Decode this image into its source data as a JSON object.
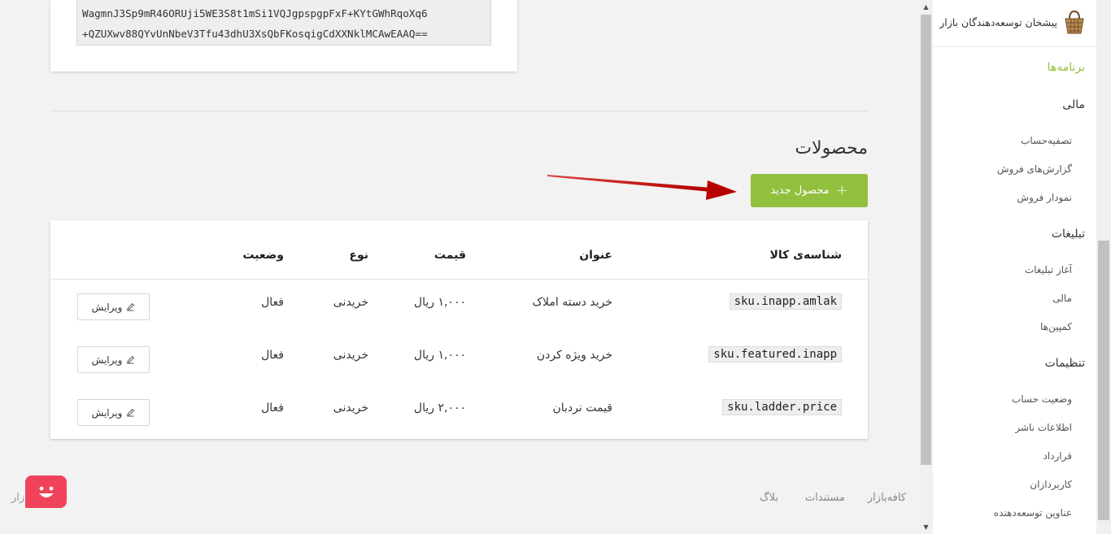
{
  "key": {
    "lines": [
      "WagmnJ3Sp9mR46ORUji5WE3S8t1mSi1VQJgpspgpFxF+KYtGWhRqoXq6",
      "+QZUXwv88QYvUnNbeV3Tfu43dhU3XsQbFKosqigCdXXNklMCAwEAAQ=="
    ]
  },
  "products": {
    "title": "محصولات",
    "new_button_label": "محصول جدید",
    "new_button_icon": "plus-icon",
    "columns": {
      "sku": "شناسه‌ی کالا",
      "title": "عنوان",
      "price": "قیمت",
      "type": "نوع",
      "status": "وضعیت"
    },
    "rows": [
      {
        "sku": "sku.inapp.amlak",
        "title": "خرید دسته املاک",
        "price": "۱,۰۰۰ ریال",
        "type": "خریدنی",
        "status": "فعال",
        "edit": "ویرایش"
      },
      {
        "sku": "sku.featured.inapp",
        "title": "خرید ویژه کردن",
        "price": "۱,۰۰۰ ریال",
        "type": "خریدنی",
        "status": "فعال",
        "edit": "ویرایش"
      },
      {
        "sku": "sku.ladder.price",
        "title": "قیمت نردبان",
        "price": "۲,۰۰۰ ریال",
        "type": "خریدنی",
        "status": "فعال",
        "edit": "ویرایش"
      }
    ]
  },
  "footer": {
    "links": [
      "کافه‌بازار",
      "مستندات",
      "بلاگ"
    ],
    "copyright": "© ۷ بازار"
  },
  "sidebar": {
    "brand": "پیشخان توسعه‌دهندگان بازار",
    "top_item": "برنامه‌ها",
    "sections": [
      {
        "label": "مالی",
        "items": [
          "تصفیه‌حساب",
          "گزارش‌های فروش",
          "نمودار فروش"
        ]
      },
      {
        "label": "تبلیغات",
        "items": [
          "آغاز تبلیغات",
          "مالی",
          "کمپین‌ها"
        ]
      },
      {
        "label": "تنظیمات",
        "items": [
          "وضعیت حساب",
          "اطلاعات ناشر",
          "قرارداد",
          "کاربردازان",
          "عناوین توسعه‌دهنده"
        ]
      }
    ]
  },
  "colors": {
    "accent": "#93bf3e",
    "arrow": "#cc1111",
    "chat": "#f0435a"
  }
}
